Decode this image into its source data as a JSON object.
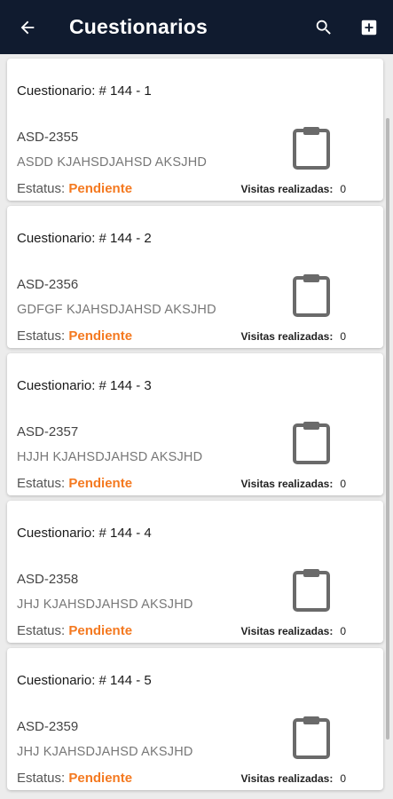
{
  "header": {
    "title": "Cuestionarios",
    "back_icon": "arrow-back-icon",
    "search_icon": "search-icon",
    "add_icon": "add-box-icon"
  },
  "colors": {
    "appbar": "#101b2f",
    "status_pending": "#f47920"
  },
  "cards": [
    {
      "title": "Cuestionario: # 144 - 1",
      "code": "ASD-2355",
      "description": "ASDD KJAHSDJAHSD AKSJHD",
      "status_label": "Estatus:",
      "status_value": "Pendiente",
      "visits_label": "Visitas realizadas:",
      "visits_value": "0"
    },
    {
      "title": "Cuestionario: # 144 - 2",
      "code": "ASD-2356",
      "description": "GDFGF KJAHSDJAHSD AKSJHD",
      "status_label": "Estatus:",
      "status_value": "Pendiente",
      "visits_label": "Visitas realizadas:",
      "visits_value": "0"
    },
    {
      "title": "Cuestionario: # 144 - 3",
      "code": "ASD-2357",
      "description": "HJJH KJAHSDJAHSD AKSJHD",
      "status_label": "Estatus:",
      "status_value": "Pendiente",
      "visits_label": "Visitas realizadas:",
      "visits_value": "0"
    },
    {
      "title": "Cuestionario: # 144 - 4",
      "code": "ASD-2358",
      "description": "JHJ KJAHSDJAHSD AKSJHD",
      "status_label": "Estatus:",
      "status_value": "Pendiente",
      "visits_label": "Visitas realizadas:",
      "visits_value": "0"
    },
    {
      "title": "Cuestionario: # 144 - 5",
      "code": "ASD-2359",
      "description": "JHJ KJAHSDJAHSD AKSJHD",
      "status_label": "Estatus:",
      "status_value": "Pendiente",
      "visits_label": "Visitas realizadas:",
      "visits_value": "0"
    }
  ]
}
